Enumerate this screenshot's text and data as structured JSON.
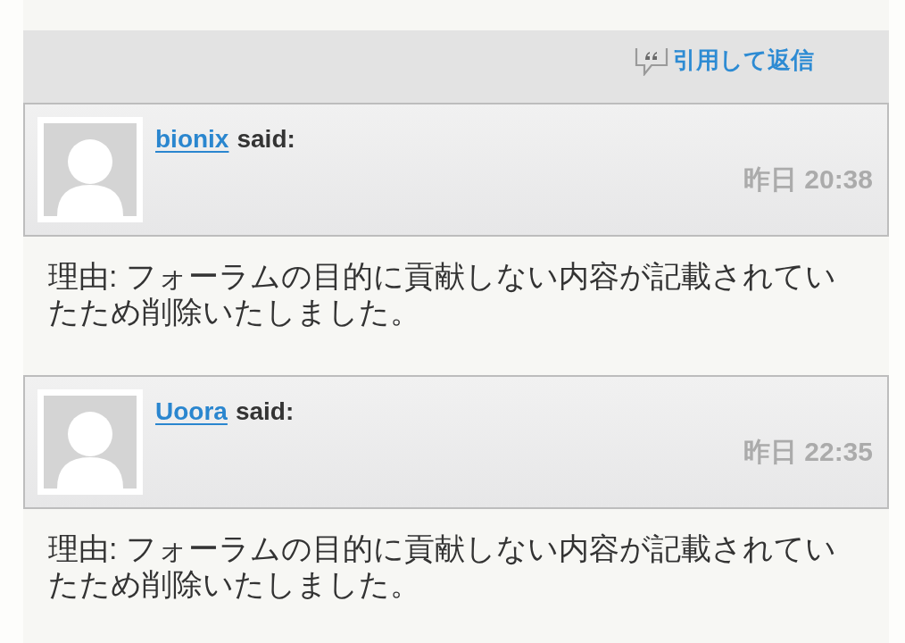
{
  "reply_bar": {
    "quote_reply": "引用して返信"
  },
  "posts": [
    {
      "quote": {
        "author": "bionix",
        "said": "said:",
        "time": "昨日 20:38"
      },
      "body": "理由: フォーラムの目的に貢献しない内容が記載されていたため削除いたしました。"
    },
    {
      "quote": {
        "author": "Uoora",
        "said": "said:",
        "time": "昨日 22:35"
      },
      "body": "理由: フォーラムの目的に貢献しない内容が記載されていたため削除いたしました。"
    }
  ]
}
